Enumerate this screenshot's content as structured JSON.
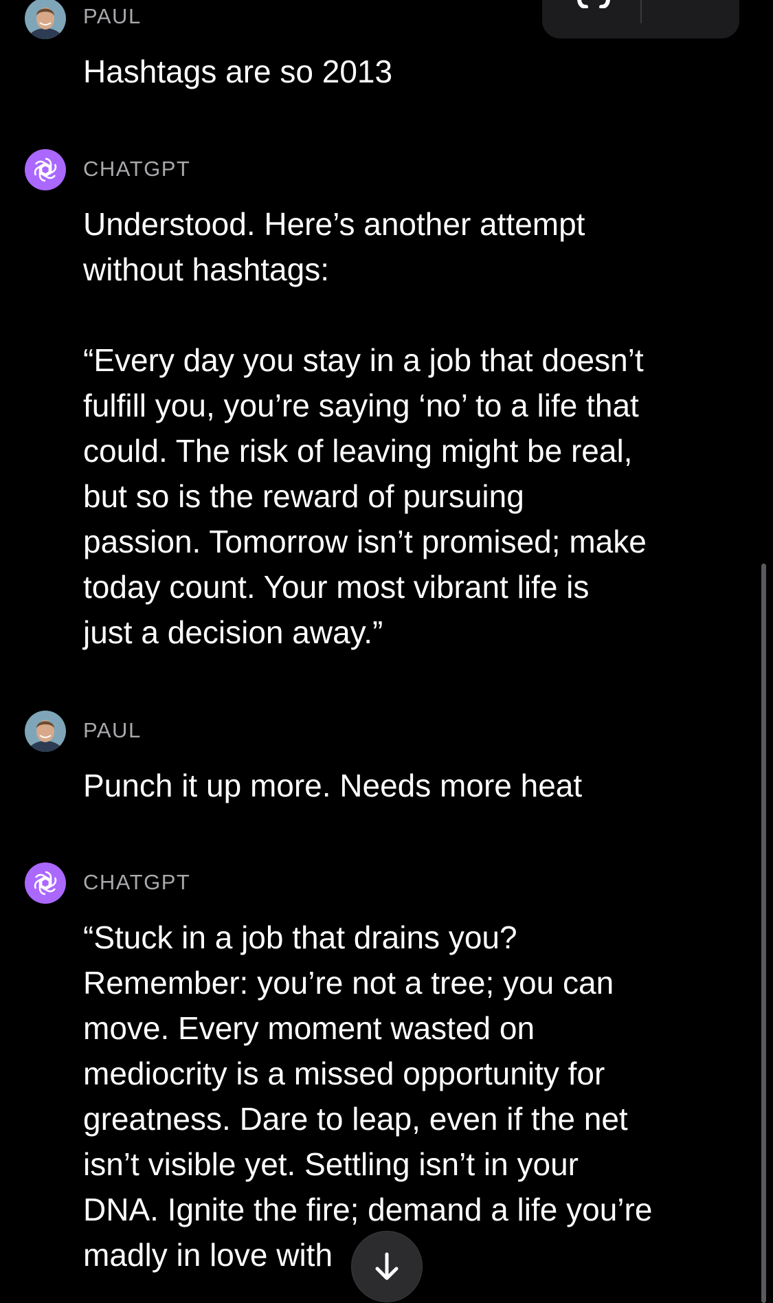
{
  "messages": [
    {
      "role": "user",
      "sender": "PAUL",
      "text": "Hashtags are so 2013"
    },
    {
      "role": "assistant",
      "sender": "CHATGPT",
      "text": "Understood. Here’s another attempt\nwithout hashtags:\n\n“Every day you stay in a job that doesn’t\nfulfill you, you’re saying ‘no’ to a life that\ncould. The risk of leaving might be real,\nbut so is the reward of pursuing\npassion. Tomorrow isn’t promised; make\ntoday count. Your most vibrant life is\njust a decision away.”"
    },
    {
      "role": "user",
      "sender": "PAUL",
      "text": "Punch it up more. Needs more heat"
    },
    {
      "role": "assistant",
      "sender": "CHATGPT",
      "text": "“Stuck in a job that drains you?\nRemember: you’re not a tree; you can\nmove. Every moment wasted on\nmediocrity is a missed opportunity for\ngreatness. Dare to leap, even if the net\nisn’t visible yet. Settling isn’t in your\nDNA. Ignite the fire; demand a life you’re\nmadly in love with"
    }
  ],
  "icons": {
    "user_avatar": "user-photo-avatar",
    "assistant_avatar": "chatgpt-logo-icon",
    "scroll_down": "arrow-down-icon",
    "top_control": "headphones-icon"
  },
  "colors": {
    "background": "#000000",
    "sender_label": "#a9a9ad",
    "message_text": "#ffffff",
    "assistant_avatar_bg": "#ab68ff",
    "scroll_button_bg": "#2c2c2e"
  }
}
